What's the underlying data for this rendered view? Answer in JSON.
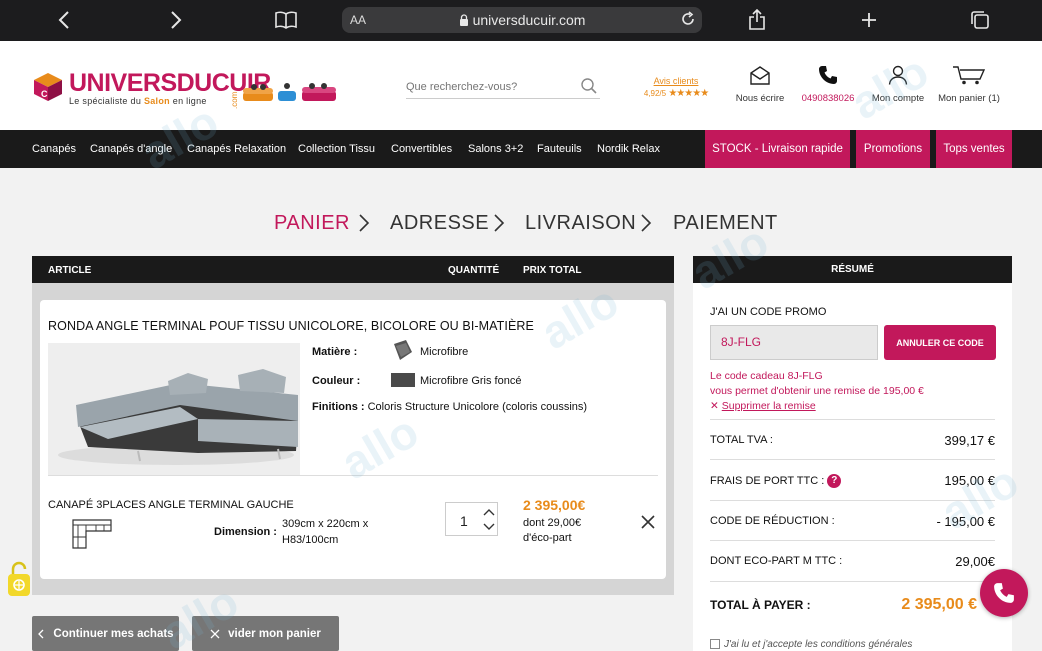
{
  "browser": {
    "aa_label": "AA",
    "url": "universducuir.com"
  },
  "header": {
    "logo_name": "UNIVERSDUCUIR",
    "logo_com": ".com",
    "logo_tag_pre": "Le spécialiste du ",
    "logo_tag_bold": "Salon",
    "logo_tag_post": " en ligne",
    "search_placeholder": "Que recherchez-vous?",
    "avis_title": "Avis clients",
    "avis_rating": "4,92/5",
    "avis_stars": "★★★★★",
    "write_label": "Nous écrire",
    "phone_label": "0490838026",
    "account_label": "Mon compte",
    "cart_label": "Mon panier (1)"
  },
  "nav": {
    "items": [
      "Canapés",
      "Canapés d'angle",
      "Canapés Relaxation",
      "Collection Tissu",
      "Convertibles",
      "Salons 3+2",
      "Fauteuils",
      "Nordik Relax"
    ],
    "pink": [
      "STOCK - Livraison rapide",
      "Promotions",
      "Tops ventes"
    ]
  },
  "steps": [
    "PANIER",
    "ADRESSE",
    "LIVRAISON",
    "PAIEMENT"
  ],
  "cart": {
    "col_article": "ARTICLE",
    "col_qty": "QUANTITÉ",
    "col_total": "PRIX TOTAL",
    "product_title": "RONDA ANGLE TERMINAL POUF TISSU UNICOLORE, BICOLORE OU BI-MATIÈRE",
    "matiere_label": "Matière :",
    "matiere_value": "Microfibre",
    "couleur_label": "Couleur :",
    "couleur_value": "Microfibre Gris foncé",
    "finitions_label": "Finitions :",
    "finitions_value": " Coloris Structure Unicolore (coloris coussins)",
    "sub_title": "CANAPÉ 3PLACES ANGLE TERMINAL GAUCHE",
    "dimension_label": "Dimension :",
    "dimension_line1": "309cm x 220cm x",
    "dimension_line2": "H83/100cm",
    "quantity": "1",
    "price": "2 395,00€",
    "eco_part": "dont 29,00€ d'éco-part",
    "continue_btn": "Continuer mes achats",
    "empty_btn": "vider mon panier"
  },
  "summary": {
    "title": "RÉSUMÉ",
    "promo_label": "J'AI UN CODE PROMO",
    "promo_code": "8J-FLG",
    "cancel_btn": "ANNULER CE CODE",
    "msg1": "Le code cadeau 8J-FLG",
    "msg2": "vous permet d'obtenir une remise de 195,00 €",
    "remove_link": "Supprimer la remise",
    "rows": [
      {
        "k": "TOTAL TVA :",
        "v": "399,17 €"
      },
      {
        "k": "FRAIS DE PORT TTC :",
        "v": "195,00 €"
      },
      {
        "k": "CODE DE RÉDUCTION :",
        "v": "- 195,00 €"
      },
      {
        "k": "DONT ECO-PART M TTC :",
        "v": "29,00€"
      }
    ],
    "total_label": "TOTAL À PAYER :",
    "total_value": "2 395,00 €",
    "cgv": "J'ai lu et j'accepte les conditions générales"
  },
  "watermark": "allo",
  "colors": {
    "brand": "#c2185b",
    "accent": "#e88b1b",
    "dark": "#1a1a1a"
  }
}
